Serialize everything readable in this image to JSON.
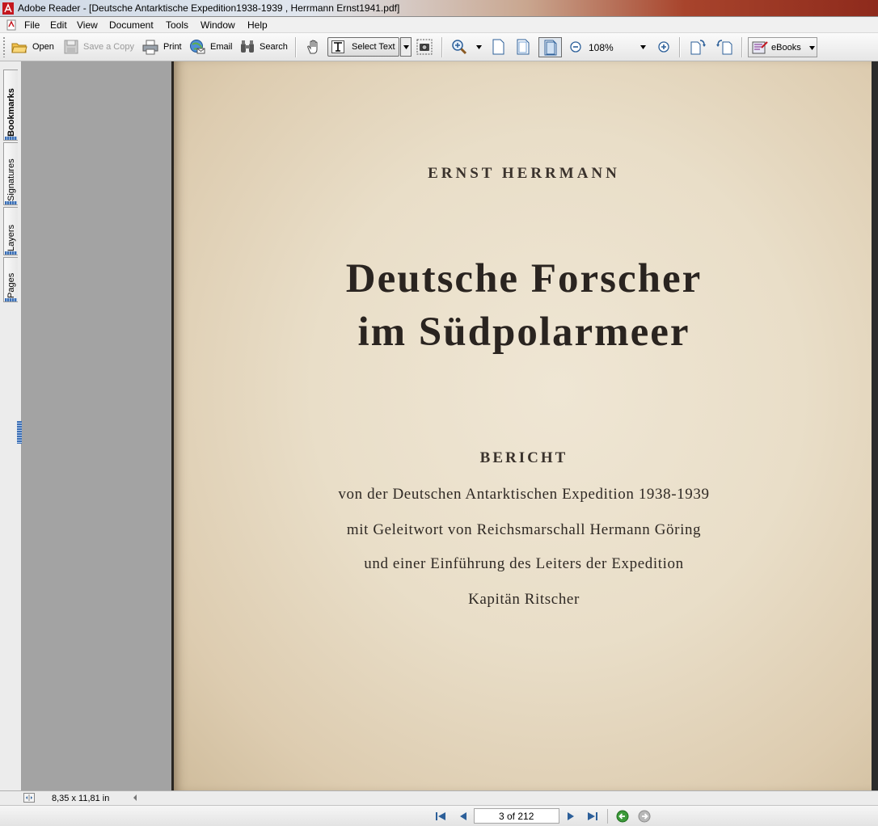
{
  "window": {
    "title": "Adobe Reader - [Deutsche Antarktische Expedition1938-1939 , Herrmann Ernst1941.pdf]"
  },
  "menu": [
    "File",
    "Edit",
    "View",
    "Document",
    "Tools",
    "Window",
    "Help"
  ],
  "toolbar": {
    "open_label": "Open",
    "save_copy_label": "Save a Copy",
    "print_label": "Print",
    "email_label": "Email",
    "search_label": "Search",
    "select_text_label": "Select Text",
    "zoom_value": "108%",
    "ebooks_label": "eBooks"
  },
  "nav_tabs": [
    "Bookmarks",
    "Signatures",
    "Layers",
    "Pages"
  ],
  "document": {
    "author": "ERNST HERRMANN",
    "title_line1": "Deutsche Forscher",
    "title_line2": "im Südpolarmeer",
    "heading": "BERICHT",
    "line1": "von der Deutschen Antarktischen Expedition 1938-1939",
    "line2": "mit Geleitwort von Reichsmarschall Hermann Göring",
    "line3": "und einer Einführung des Leiters der Expedition",
    "line4": "Kapitän Ritscher"
  },
  "status": {
    "page_size": "8,35 x 11,81 in"
  },
  "navigation": {
    "page_indicator": "3 of 212"
  }
}
